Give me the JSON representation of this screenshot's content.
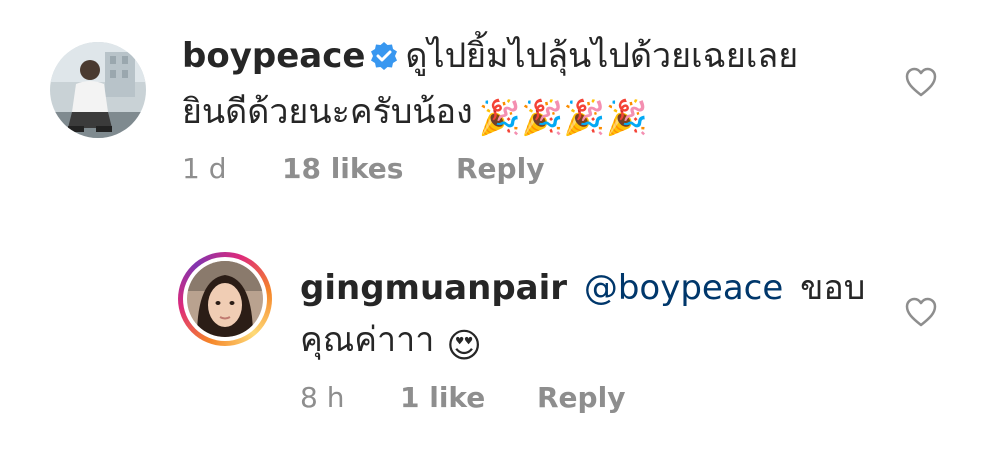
{
  "comments": [
    {
      "username": "boypeace",
      "verified": true,
      "text_line1": "ดูไปยิ้มไปลุ้นไปด้วยเฉยเลย",
      "text_line2": "ยินดีด้วยนะครับน้อง",
      "emoji": "🎉🎉🎉🎉",
      "time": "1 d",
      "likes": "18 likes",
      "reply": "Reply",
      "avatar_icon": "user-photo-avatar",
      "like_icon": "heart-outline-icon"
    },
    {
      "username": "gingmuanpair",
      "mention": "@boypeace",
      "text_line1_after": "ขอบ",
      "text_line2": "คุณค่าาา",
      "emoji": "😍",
      "time": "8 h",
      "likes": "1 like",
      "reply": "Reply",
      "avatar_icon": "story-ring-avatar",
      "like_icon": "heart-outline-icon"
    }
  ],
  "colors": {
    "username": "#262626",
    "mention": "#00376b",
    "meta": "#8e8e8e",
    "verified": "#3897f0"
  }
}
